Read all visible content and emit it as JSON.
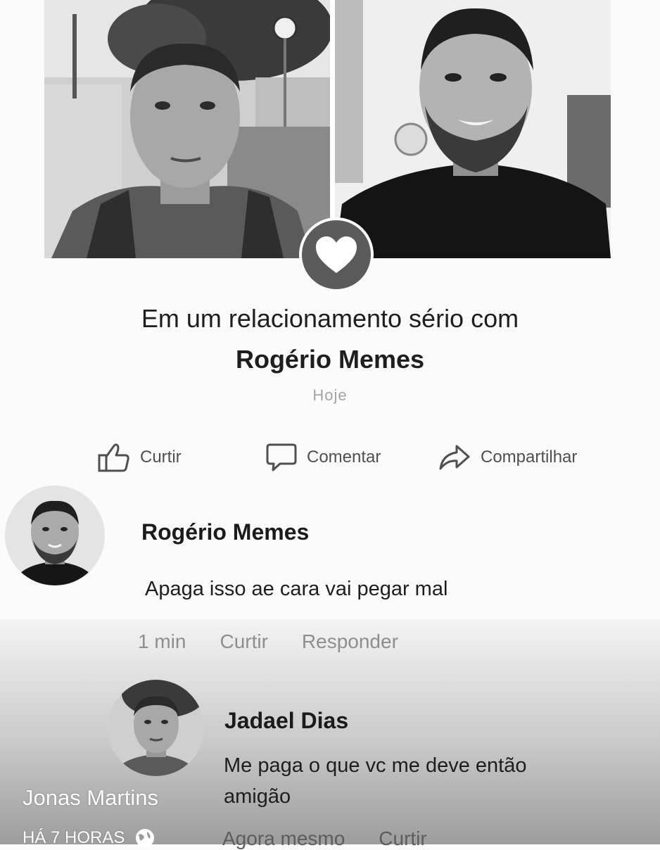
{
  "post": {
    "headline": "Em um relacionamento sério com",
    "partner": "Rogério Memes",
    "date": "Hoje"
  },
  "actions": {
    "like": "Curtir",
    "comment": "Comentar",
    "share": "Compartilhar"
  },
  "comments": [
    {
      "author": "Rogério Memes",
      "text": "Apaga isso ae cara vai pegar mal",
      "time": "1 min",
      "like": "Curtir",
      "reply": "Responder"
    },
    {
      "author": "Jadael Dias",
      "text_line1": "Me paga o que vc me deve então",
      "text_line2": "amigão",
      "time": "Agora mesmo",
      "like": "Curtir"
    }
  ],
  "watermark": {
    "name": "Jonas Martins",
    "time": "HÁ 7 HORAS"
  },
  "icons": {
    "heart": "heart-icon",
    "like": "thumbs-up-icon",
    "comment": "speech-bubble-icon",
    "share": "share-arrow-icon",
    "globe": "globe-icon"
  }
}
